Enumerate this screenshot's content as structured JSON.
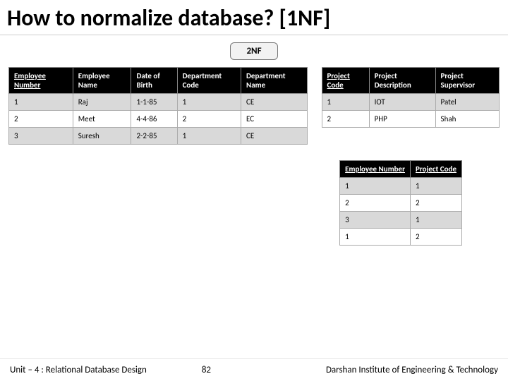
{
  "title": "How to normalize database? [1NF]",
  "badge": "2NF",
  "employee": {
    "headers": {
      "num": "Employee Number",
      "name": "Employee Name",
      "dob": "Date of Birth",
      "dcode": "Department Code",
      "dname": "Department Name"
    },
    "rows": [
      {
        "num": "1",
        "name": "Raj",
        "dob": "1-1-85",
        "dcode": "1",
        "dname": "CE"
      },
      {
        "num": "2",
        "name": "Meet",
        "dob": "4-4-86",
        "dcode": "2",
        "dname": "EC"
      },
      {
        "num": "3",
        "name": "Suresh",
        "dob": "2-2-85",
        "dcode": "1",
        "dname": "CE"
      }
    ]
  },
  "project": {
    "headers": {
      "code": "Project Code",
      "desc": "Project Description",
      "sup": "Project Supervisor"
    },
    "rows": [
      {
        "code": "1",
        "desc": "IOT",
        "sup": "Patel"
      },
      {
        "code": "2",
        "desc": "PHP",
        "sup": "Shah"
      }
    ]
  },
  "link": {
    "headers": {
      "emp": "Employee Number",
      "proj": "Project Code"
    },
    "rows": [
      {
        "emp": "1",
        "proj": "1"
      },
      {
        "emp": "2",
        "proj": "2"
      },
      {
        "emp": "3",
        "proj": "1"
      },
      {
        "emp": "1",
        "proj": "2"
      }
    ]
  },
  "footer": {
    "unit": "Unit – 4 : Relational Database Design",
    "page": "82",
    "inst": "Darshan Institute of Engineering & Technology"
  }
}
